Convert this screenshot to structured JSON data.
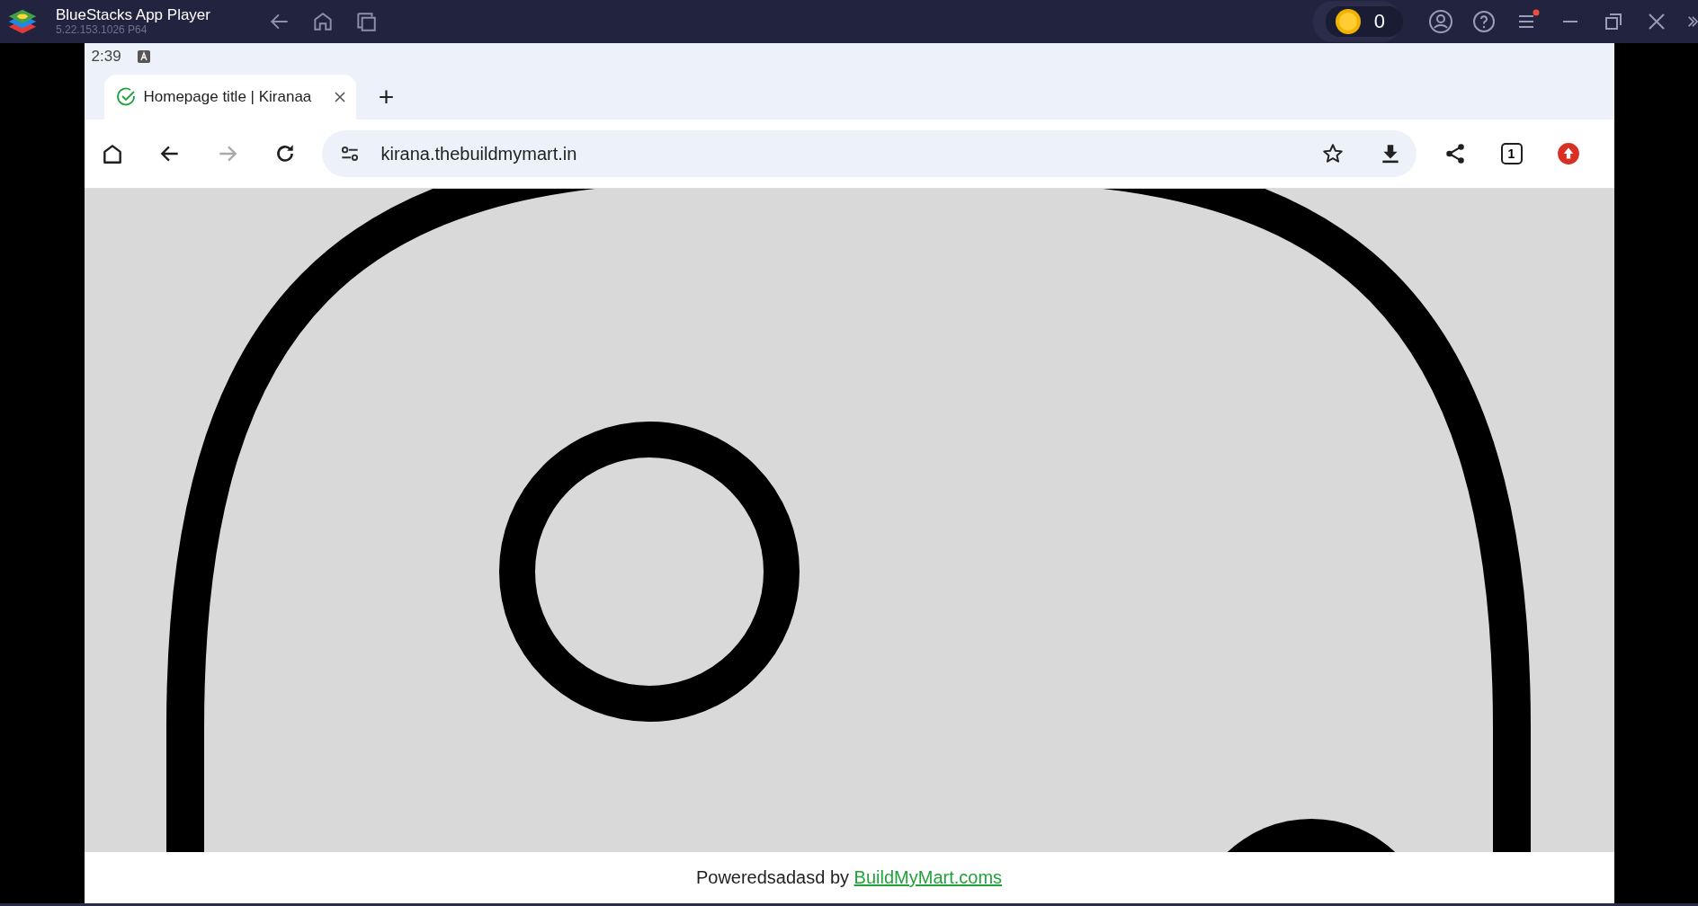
{
  "window": {
    "title": "BlueStacks App Player",
    "version": "5.22.153.1026  P64",
    "coins": "0",
    "menu_notification": true
  },
  "status_bar": {
    "time": "2:39"
  },
  "browser": {
    "tabs": [
      {
        "title": "Homepage title | Kiranaa",
        "selected": true
      }
    ],
    "new_tab": "+",
    "address": "kirana.thebuildmymart.in",
    "tab_count": "1",
    "forward_disabled": true
  },
  "footer": {
    "text": "Poweredsadasd by ",
    "link": "BuildMyMart.coms"
  }
}
